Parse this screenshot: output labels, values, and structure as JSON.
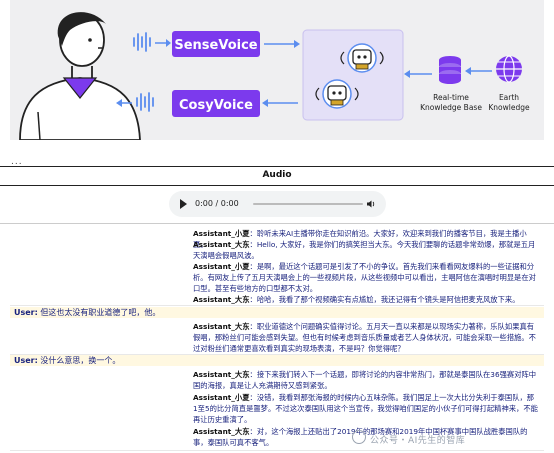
{
  "banner": {
    "sensevoice_label": "SenseVoice",
    "cosyvoice_label": "CosyVoice",
    "kb_label_line1": "Real-time",
    "kb_label_line2": "Knowledge Base",
    "earth_label_line1": "Earth",
    "earth_label_line2": "Knowledge",
    "accent_purple": "#7c3aed",
    "panel_color": "#e4e0f7"
  },
  "ellipsis": "...",
  "table": {
    "column_header": "Audio",
    "audio_time": "0:00 / 0:00"
  },
  "conversation": [
    {
      "speaker": "Assistant_小夏",
      "sep": "：",
      "text": "聆听未来AI主播带你走在知识前沿。大家好，欢迎来到我们的播客节目，我是主播小夏。"
    },
    {
      "speaker": "Assistant_大东",
      "sep": "：",
      "text": "Hello, 大家好，我是你们的搞笑担当大东。今天我们要聊的话题非常劲爆，那就是五月天演唱会假唱风波。"
    },
    {
      "speaker": "Assistant_小夏",
      "sep": "：",
      "text": "是啊，最近这个话题可是引发了不小的争议。首先我们来看看网友爆料的一些证据和分析。有网友上传了五月天演唱会上的一些视频片段，从这些视频中可以看出，主唱阿信在演唱时明显是在对口型。甚至有些地方的口型都不太对。"
    },
    {
      "speaker": "Assistant_大东",
      "sep": "：",
      "text": "哈哈，我看了那个视频确实有点尴尬，我还记得有个镜头是阿信把麦克风放下来。"
    },
    {
      "user": "User:",
      "text": " 但这也太没有职业道德了吧，他。"
    },
    {
      "speaker": "Assistant_大东",
      "sep": "：",
      "text": "职业道德这个问题确实值得讨论。五月天一直以来都是以现场实力著称，乐队如果真有假唱，那粉丝们可能会感到失望。但也有时候考虑到音乐质量或者艺人身体状况，可能会采取一些措施。不过对粉丝们通常更喜欢看到真实的现场表演，不是吗？你觉得呢？"
    },
    {
      "user": "User:",
      "text": " 没什么意思，换一个。"
    },
    {
      "speaker": "Assistant_大东",
      "sep": "：",
      "text": "接下来我们转入下一个话题，即将讨论的内容非常热门，那就是泰国队在36强赛对阵中国的海报，真是让人充满期待又感到紧张。"
    },
    {
      "speaker": "Assistant_小夏",
      "sep": "：",
      "text": "没错，我看到那张海报的时候内心五味杂陈。我们国足上一次大比分失利于泰国队，那1至5的比分简直是噩梦。不过这次泰国队用这个当宣传，我觉得咱们国足的小伙子们可得打起精神来，不能再让历史重演了。"
    },
    {
      "speaker": "Assistant_大东",
      "sep": "：",
      "text": "对，这个海报上还贴出了2019年的那场赛和2019年中国杯赛事中国队战胜泰国队的事，泰国队可真不客气。"
    }
  ],
  "watermark": "公众号・AI先生的智库"
}
